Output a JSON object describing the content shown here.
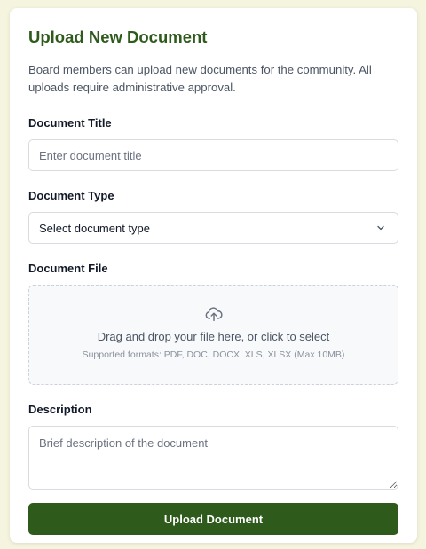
{
  "form": {
    "title": "Upload New Document",
    "description": "Board members can upload new documents for the community. All uploads require administrative approval.",
    "title_field": {
      "label": "Document Title",
      "placeholder": "Enter document title",
      "value": ""
    },
    "type_field": {
      "label": "Document Type",
      "selected": "Select document type"
    },
    "file_field": {
      "label": "Document File",
      "drop_text": "Drag and drop your file here, or click to select",
      "formats_text": "Supported formats: PDF, DOC, DOCX, XLS, XLSX (Max 10MB)",
      "icon": "cloud-upload-icon"
    },
    "description_field": {
      "label": "Description",
      "placeholder": "Brief description of the document",
      "value": ""
    },
    "submit_label": "Upload Document"
  },
  "colors": {
    "accent": "#2e5a1c",
    "background": "#f5f4df"
  }
}
